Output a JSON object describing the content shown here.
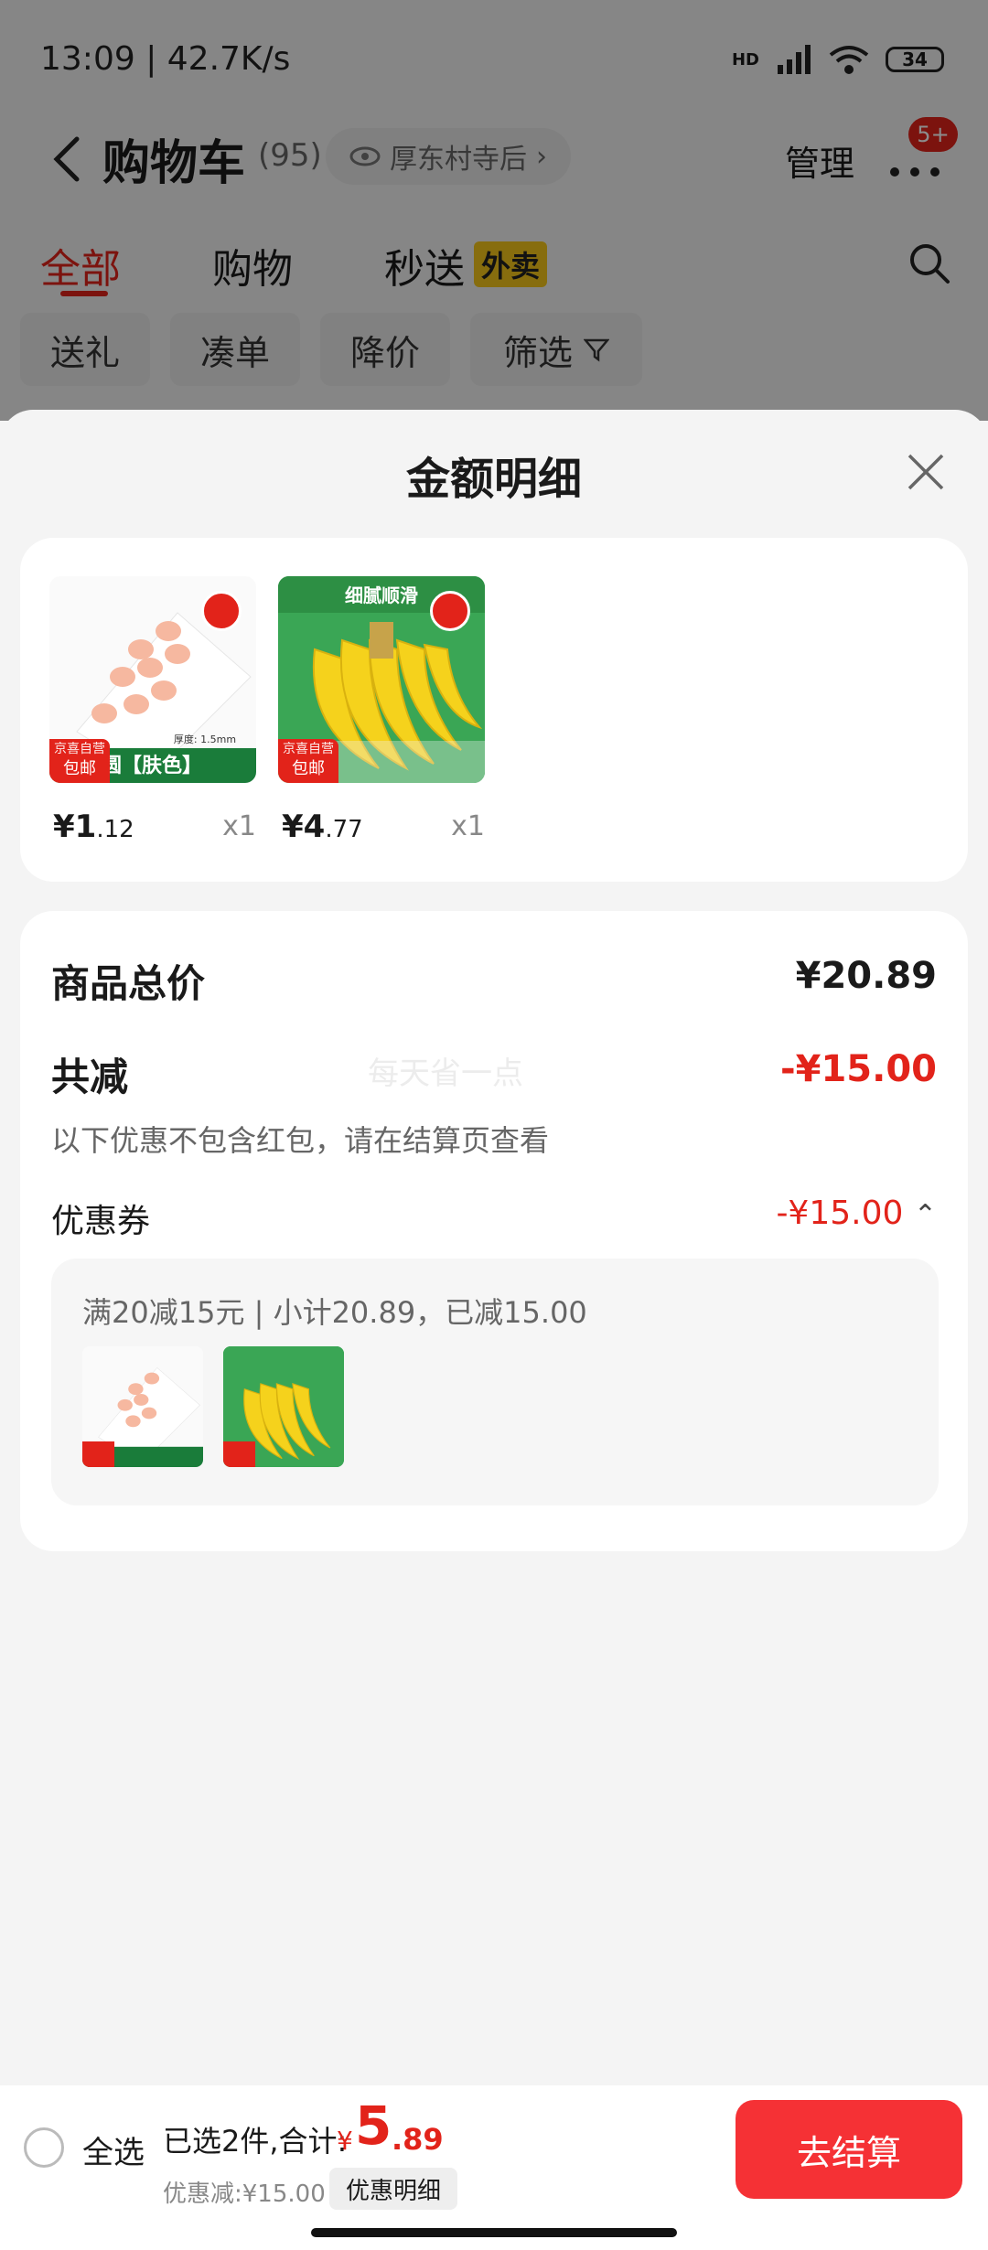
{
  "status_bar": {
    "time": "13:09 | 42.7K/s",
    "battery": "34",
    "network": "HD"
  },
  "nav": {
    "title": "购物车",
    "count": "(95)",
    "location": "厚东村寺后",
    "manage": "管理",
    "badge": "5+"
  },
  "tabs": [
    {
      "label": "全部"
    },
    {
      "label": "购物"
    },
    {
      "label": "秒送"
    }
  ],
  "tab_tag": "外卖",
  "filters": [
    "送礼",
    "凑单",
    "降价",
    "筛选"
  ],
  "sheet": {
    "title": "金额明细",
    "products": [
      {
        "price_main": "¥1",
        "price_dec": ".12",
        "qty": "x1",
        "image": "pads",
        "tag_top": "京喜自营",
        "tag_bottom": "包邮",
        "img_text": "圆【肤色】",
        "img_sub": "厚度: 1.5mm"
      },
      {
        "price_main": "¥4",
        "price_dec": ".77",
        "qty": "x1",
        "image": "banana",
        "tag_top": "京喜自营",
        "tag_bottom": "包邮",
        "img_text": "细腻顺滑"
      }
    ],
    "total_label": "商品总价",
    "total_value": "¥20.89",
    "reduce_label": "共减",
    "reduce_value": "-¥15.00",
    "watermark": "每天省一点",
    "note": "以下优惠不包含红包，请在结算页查看",
    "coupon_label": "优惠券",
    "coupon_value": "-¥15.00",
    "coupon_desc": "满20减15元 | 小计20.89，已减15.00"
  },
  "bottom": {
    "select_all": "全选",
    "selected": "已选2件,合计:",
    "yen": "¥",
    "total_int": "5",
    "total_dec": ".89",
    "discount": "优惠减:¥15.00",
    "detail_btn": "优惠明细",
    "checkout": "去结算"
  },
  "colors": {
    "accent": "#e2231a",
    "checkout": "#f53135",
    "waimai": "#f6c61a"
  }
}
